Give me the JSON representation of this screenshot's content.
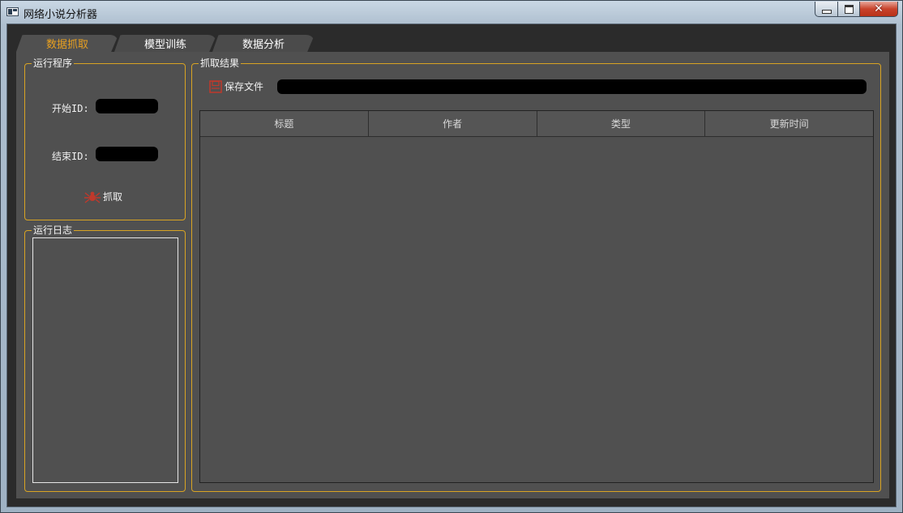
{
  "window": {
    "title": "网络小说分析器",
    "controls": {
      "minimize": "—",
      "maximize": "□",
      "close": "✕"
    }
  },
  "tabs": [
    {
      "label": "数据抓取",
      "active": true
    },
    {
      "label": "模型训练",
      "active": false
    },
    {
      "label": "数据分析",
      "active": false
    }
  ],
  "run_group": {
    "title": "运行程序",
    "start_id_label": "开始ID:",
    "start_id_value": "",
    "end_id_label": "结束ID:",
    "end_id_value": "",
    "fetch_button": "抓取",
    "fetch_icon": "spider-icon"
  },
  "log_group": {
    "title": "运行日志",
    "content": ""
  },
  "result_group": {
    "title": "抓取结果",
    "save_button": "保存文件",
    "save_icon": "save-icon",
    "file_path": "",
    "table": {
      "columns": [
        "标题",
        "作者",
        "类型",
        "更新时间"
      ],
      "rows": []
    }
  },
  "colors": {
    "accent": "#e8a020",
    "group_border": "#d9a423",
    "panel_bg": "#505050",
    "icon_red": "#c0392b"
  }
}
